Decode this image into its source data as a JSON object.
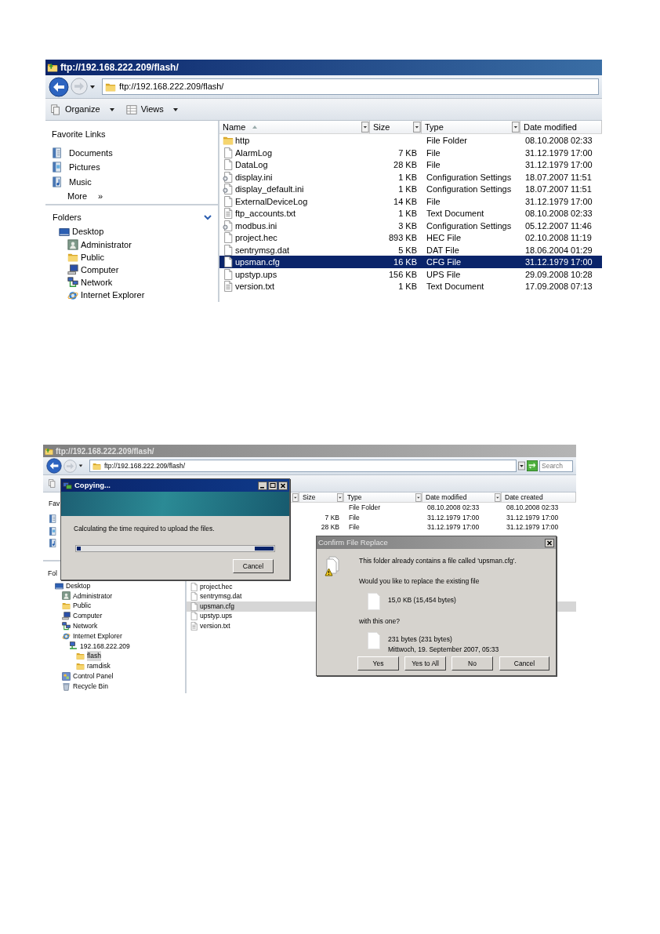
{
  "windows": [
    {
      "active": true,
      "title": "ftp://192.168.222.209/flash/",
      "address": "ftp://192.168.222.209/flash/",
      "toolbar": [
        {
          "kind": "organize",
          "label": "Organize"
        },
        {
          "kind": "views",
          "label": "Views"
        }
      ],
      "favorite_links": {
        "heading": "Favorite Links",
        "items": [
          {
            "kind": "documents",
            "label": "Documents"
          },
          {
            "kind": "pictures",
            "label": "Pictures"
          },
          {
            "kind": "music",
            "label": "Music"
          }
        ],
        "more": "More",
        "more_glyph": "»"
      },
      "folders": {
        "heading": "Folders",
        "chevron": true,
        "tree": [
          {
            "kind": "desktop",
            "label": "Desktop",
            "children": [
              {
                "kind": "user",
                "label": "Administrator"
              },
              {
                "kind": "folder",
                "label": "Public"
              },
              {
                "kind": "computer",
                "label": "Computer"
              },
              {
                "kind": "network",
                "label": "Network"
              },
              {
                "kind": "ie",
                "label": "Internet Explorer"
              }
            ]
          }
        ]
      },
      "name_column": {
        "label": "Name",
        "sorted": true
      },
      "columns": [
        "Size",
        "Type",
        "Date modified"
      ],
      "file_groups": [
        [
          {
            "kind": "folder",
            "name": "http",
            "type": "File Folder",
            "date_modified": "08.10.2008 02:33",
            "selected": false
          },
          {
            "kind": "file",
            "name": "AlarmLog",
            "size": "7 KB",
            "type": "File",
            "date_modified": "31.12.1979 17:00",
            "selected": false
          },
          {
            "kind": "file",
            "name": "DataLog",
            "size": "28 KB",
            "type": "File",
            "date_modified": "31.12.1979 17:00",
            "selected": false
          },
          {
            "kind": "settings",
            "name": "display.ini",
            "size": "1 KB",
            "type": "Configuration Settings",
            "date_modified": "18.07.2007 11:51",
            "selected": false
          },
          {
            "kind": "settings",
            "name": "display_default.ini",
            "size": "1 KB",
            "type": "Configuration Settings",
            "date_modified": "18.07.2007 11:51",
            "selected": false
          },
          {
            "kind": "file",
            "name": "ExternalDeviceLog",
            "size": "14 KB",
            "type": "File",
            "date_modified": "31.12.1979 17:00",
            "selected": false
          },
          {
            "kind": "text",
            "name": "ftp_accounts.txt",
            "size": "1 KB",
            "type": "Text Document",
            "date_modified": "08.10.2008 02:33",
            "selected": false
          },
          {
            "kind": "settings",
            "name": "modbus.ini",
            "size": "3 KB",
            "type": "Configuration Settings",
            "date_modified": "05.12.2007 11:46",
            "selected": false
          },
          {
            "kind": "file",
            "name": "project.hec",
            "size": "893 KB",
            "type": "HEC File",
            "date_modified": "02.10.2008 11:19",
            "selected": false
          },
          {
            "kind": "file",
            "name": "sentrymsg.dat",
            "size": "5 KB",
            "type": "DAT File",
            "date_modified": "18.06.2004 01:29",
            "selected": false
          },
          {
            "kind": "file",
            "name": "upsman.cfg",
            "size": "16 KB",
            "type": "CFG File",
            "date_modified": "31.12.1979 17:00",
            "selected": true
          },
          {
            "kind": "file",
            "name": "upstyp.ups",
            "size": "156 KB",
            "type": "UPS File",
            "date_modified": "29.09.2008 10:28",
            "selected": false
          },
          {
            "kind": "text",
            "name": "version.txt",
            "size": "1 KB",
            "type": "Text Document",
            "date_modified": "17.09.2008 07:13",
            "selected": false
          }
        ]
      ]
    },
    {
      "active": false,
      "title": "ftp://192.168.222.209/flash/",
      "address": "ftp://192.168.222.209/flash/",
      "search": {
        "placeholder": "Search"
      },
      "toolbar": [
        {
          "kind": "organize"
        }
      ],
      "favorite_links": {
        "heading": "Fav",
        "items": [
          {
            "kind": "documents"
          },
          {
            "kind": "pictures"
          },
          {
            "kind": "music"
          }
        ]
      },
      "folders": {
        "heading": "Fol",
        "tree": [
          {
            "kind": "desktop",
            "label": "Desktop",
            "selected": false,
            "children": [
              {
                "kind": "user",
                "label": "Administrator",
                "selected": false
              },
              {
                "kind": "folder",
                "label": "Public",
                "selected": false
              },
              {
                "kind": "computer",
                "label": "Computer",
                "selected": false
              },
              {
                "kind": "network",
                "label": "Network",
                "selected": false
              },
              {
                "kind": "ie",
                "label": "Internet Explorer",
                "selected": false,
                "children": [
                  {
                    "kind": "server",
                    "label": "192.168.222.209",
                    "selected": false,
                    "children": [
                      {
                        "kind": "folder",
                        "label": "flash",
                        "selected": true
                      },
                      {
                        "kind": "folder",
                        "label": "ramdisk",
                        "selected": false
                      }
                    ]
                  }
                ]
              },
              {
                "kind": "control",
                "label": "Control Panel",
                "selected": false
              },
              {
                "kind": "recycle",
                "label": "Recycle Bin",
                "selected": false
              }
            ]
          }
        ]
      },
      "columns": [
        "Size",
        "Type",
        "Date modified",
        "Date created"
      ],
      "file_groups": [
        [
          {
            "type": "File Folder",
            "date_modified": "08.10.2008 02:33",
            "date_created": "08.10.2008 02:33",
            "selected": false
          },
          {
            "size": "7 KB",
            "type": "File",
            "date_modified": "31.12.1979 17:00",
            "date_created": "31.12.1979 17:00",
            "selected": false
          },
          {
            "size": "28 KB",
            "type": "File",
            "date_modified": "31.12.1979 17:00",
            "date_created": "31.12.1979 17:00",
            "selected": false
          }
        ],
        [
          {
            "kind": "file",
            "name": "project.hec",
            "selected": false
          },
          {
            "kind": "file",
            "name": "sentrymsg.dat",
            "selected": false
          },
          {
            "kind": "file",
            "name": "upsman.cfg",
            "selected": true
          },
          {
            "kind": "file",
            "name": "upstyp.ups",
            "selected": false
          },
          {
            "kind": "text",
            "name": "version.txt",
            "selected": false
          }
        ]
      ],
      "copying_dialog": {
        "title": "Copying...",
        "message": "Calculating the time required to upload the files.",
        "level": 0.02,
        "button": "Cancel"
      },
      "replace_dialog": {
        "title": "Confirm File Replace",
        "message": "This folder already contains a file called 'upsman.cfg'.",
        "question": "Would you like to replace the existing file",
        "existing": [
          "15,0 KB (15,454 bytes)"
        ],
        "with_label": "with this one?",
        "replacement": [
          "231 bytes (231 bytes)",
          "Mittwoch, 19. September 2007, 05:33"
        ],
        "buttons": [
          "Yes",
          "Yes to All",
          "No",
          "Cancel"
        ]
      }
    }
  ]
}
